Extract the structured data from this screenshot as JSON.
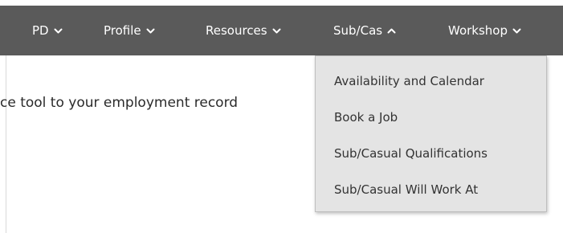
{
  "nav": {
    "items": [
      {
        "label": "PD",
        "chevron": "chevron-down-icon"
      },
      {
        "label": "Profile",
        "chevron": "chevron-down-icon"
      },
      {
        "label": "Resources",
        "chevron": "chevron-down-icon"
      },
      {
        "label": "Sub/Cas",
        "chevron": "chevron-up-icon"
      },
      {
        "label": "Workshop",
        "chevron": "chevron-down-icon"
      }
    ],
    "background_color": "#5a5a5a"
  },
  "content": {
    "text": "ce tool to your employment record"
  },
  "dropdown": {
    "items": [
      {
        "label": "Availability and Calendar"
      },
      {
        "label": "Book a Job"
      },
      {
        "label": "Sub/Casual Qualifications"
      },
      {
        "label": "Sub/Casual Will Work At"
      }
    ],
    "background_color": "#e4e4e4"
  }
}
